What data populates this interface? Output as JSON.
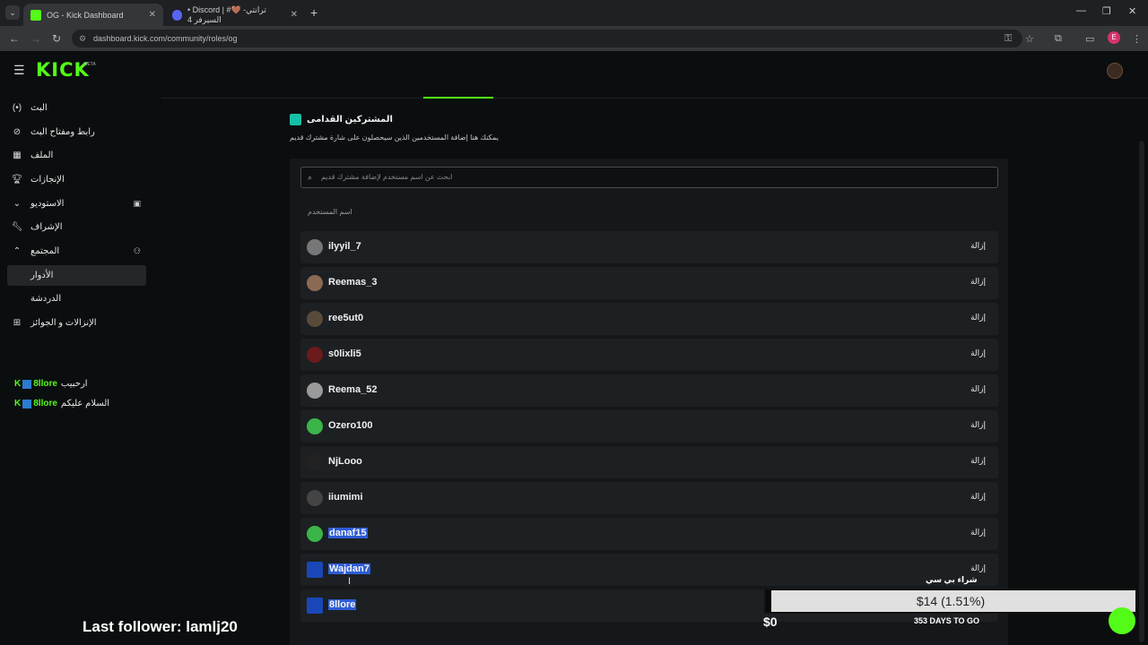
{
  "browser": {
    "tabs": [
      {
        "title": "OG - Kick Dashboard",
        "active": true
      },
      {
        "title": "• Discord | #🤎 ترانتي-السيرفر 4",
        "active": false
      }
    ],
    "url": "dashboard.kick.com/community/roles/og"
  },
  "header": {
    "logo": "KICK",
    "beta": "BETA"
  },
  "sidebar": {
    "items": [
      {
        "label": "البث",
        "icon": "broadcast-icon"
      },
      {
        "label": "رابط ومفتاح البث",
        "icon": "link-icon"
      },
      {
        "label": "الملف",
        "icon": "profile-icon"
      },
      {
        "label": "الإنجازات",
        "icon": "trophy-icon"
      },
      {
        "label": "الاستوديو",
        "icon": "chevron-down-icon"
      },
      {
        "label": "الإشراف",
        "icon": "wrench-icon"
      },
      {
        "label": "المجتمع",
        "icon": "chevron-up-icon"
      },
      {
        "label": "الأدوار",
        "icon": ""
      },
      {
        "label": "الدردشة",
        "icon": ""
      },
      {
        "label": "الإنزالات و الجوائز",
        "icon": "gift-icon"
      }
    ]
  },
  "chat_overlay": [
    {
      "name": "8llore",
      "message": "ارحبيب"
    },
    {
      "name": "8llore",
      "message": "السلام عليكم"
    }
  ],
  "section": {
    "title": "المشتركين القدامى",
    "description": "يمكنك هنا إضافة المستخدمين الذين سيحصلون على شارة مشترك قديم",
    "search_placeholder": "ابحث عن اسم مستخدم لإضافة مشترك قديم",
    "column_header": "اسم المستخدم",
    "remove_label": "إزالة"
  },
  "users": [
    {
      "name": "ilyyil_7",
      "avatar": "#777",
      "highlight": false
    },
    {
      "name": "Reemas_3",
      "avatar": "#8a6a55",
      "highlight": false
    },
    {
      "name": "ree5ut0",
      "avatar": "#5a4a3a",
      "highlight": false
    },
    {
      "name": "s0lixli5",
      "avatar": "#6b1a1a",
      "highlight": false
    },
    {
      "name": "Reema_52",
      "avatar": "#9a9a9a",
      "highlight": false
    },
    {
      "name": "Ozero100",
      "avatar": "#3bb54a",
      "highlight": false
    },
    {
      "name": "NjLooo",
      "avatar": "#222",
      "highlight": false
    },
    {
      "name": "iiumimi",
      "avatar": "#444",
      "highlight": false
    },
    {
      "name": "danaf15",
      "avatar": "#3bb54a",
      "highlight": true
    },
    {
      "name": "Wajdan7",
      "avatar": "#1a47b8",
      "highlight": true
    },
    {
      "name": "8llore",
      "avatar": "#1a47b8",
      "highlight": true
    }
  ],
  "overlay": {
    "last_follower": "Last follower: lamlj20",
    "goal_label": "شراء بي سي",
    "goal_amount": "$14 (1.51%)",
    "goal_progress": 0.0151,
    "goal_start": "$0",
    "goal_days": "353 DAYS TO GO"
  },
  "colors": {
    "accent": "#53fc18",
    "selection": "#2d5cd6"
  }
}
